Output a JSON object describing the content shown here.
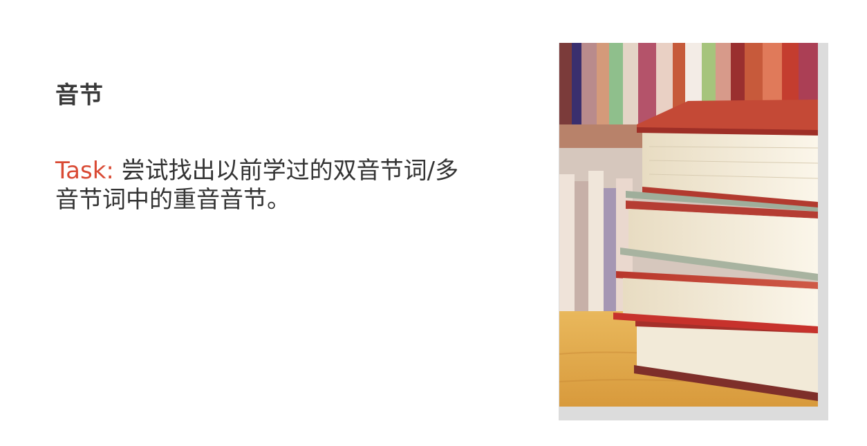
{
  "slide": {
    "title": "音节",
    "task_label": "Task:",
    "task_text": " 尝试找出以前学过的双音节词/多音节词中的重音音节。"
  },
  "colors": {
    "accent": "#d94a34",
    "text": "#333333"
  },
  "image": {
    "subject": "stack-of-books-photo"
  }
}
